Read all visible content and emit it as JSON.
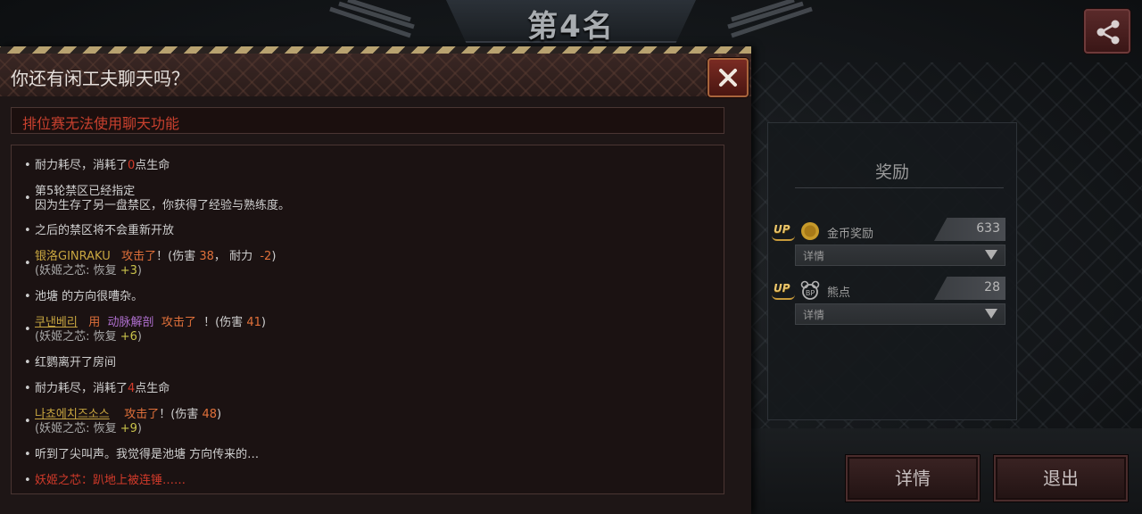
{
  "header": {
    "rank_title": "第4名"
  },
  "share": {
    "icon": "share-icon"
  },
  "dialog": {
    "title": "你还有闲工夫聊天吗？",
    "notice": "排位赛无法使用聊天功能",
    "log": {
      "l1_pre": "耐力耗尽，消耗了",
      "l1_num": "0",
      "l1_post": "点生命",
      "l2_a": "第5轮禁区已经指定",
      "l2_b": "因为生存了另一盘禁区，你获得了经验与熟练度。",
      "l3": "之后的禁区将不会重新开放",
      "l4_name": "银洛GINRAKU",
      "l4_attack": "攻击了",
      "l4_mid": "！(伤害",
      "l4_dmg": "38",
      "l4_sep": "，",
      "l4_stam_label": "耐力",
      "l4_stam": "-2",
      "l4_close": ")",
      "l4_sub_pre": "(妖姬之芯: 恢复",
      "l4_sub_val": "+3",
      "l4_sub_close": ")",
      "l5": "池塘 的方向很嘈杂。",
      "l6_name": "쿠낸베리",
      "l6_use": "用",
      "l6_skill": "动脉解剖",
      "l6_attack": "攻击了",
      "l6_mid": "！(伤害",
      "l6_dmg": "41",
      "l6_close": ")",
      "l6_sub_pre": "(妖姬之芯: 恢复",
      "l6_sub_val": "+6",
      "l6_sub_close": ")",
      "l7": "红鹦离开了房间",
      "l8_pre": "耐力耗尽，消耗了",
      "l8_num": "4",
      "l8_post": "点生命",
      "l9_name": "나쵸에치즈소스",
      "l9_attack": "攻击了",
      "l9_mid": "！(伤害",
      "l9_dmg": "48",
      "l9_close": ")",
      "l9_sub_pre": "(妖姬之芯: 恢复",
      "l9_sub_val": "+9",
      "l9_sub_close": ")",
      "l10": "听到了尖叫声。我觉得是池塘 方向传来的…",
      "l11": "妖姬之芯：趴地上被连锤……"
    }
  },
  "rewards": {
    "title": "奖励",
    "items": [
      {
        "badge": "UP",
        "icon": "gold-coin-icon",
        "label": "金币奖励",
        "value": "633",
        "detail": "详情"
      },
      {
        "badge": "UP",
        "icon": "bear-point-icon",
        "label": "熊点",
        "value": "28",
        "detail": "详情"
      }
    ]
  },
  "buttons": {
    "detail": "详情",
    "exit": "退出"
  },
  "colors": {
    "accent_red": "#d23a2a",
    "hazard_gold": "#b8a270",
    "up_gold": "#e9c46a"
  }
}
